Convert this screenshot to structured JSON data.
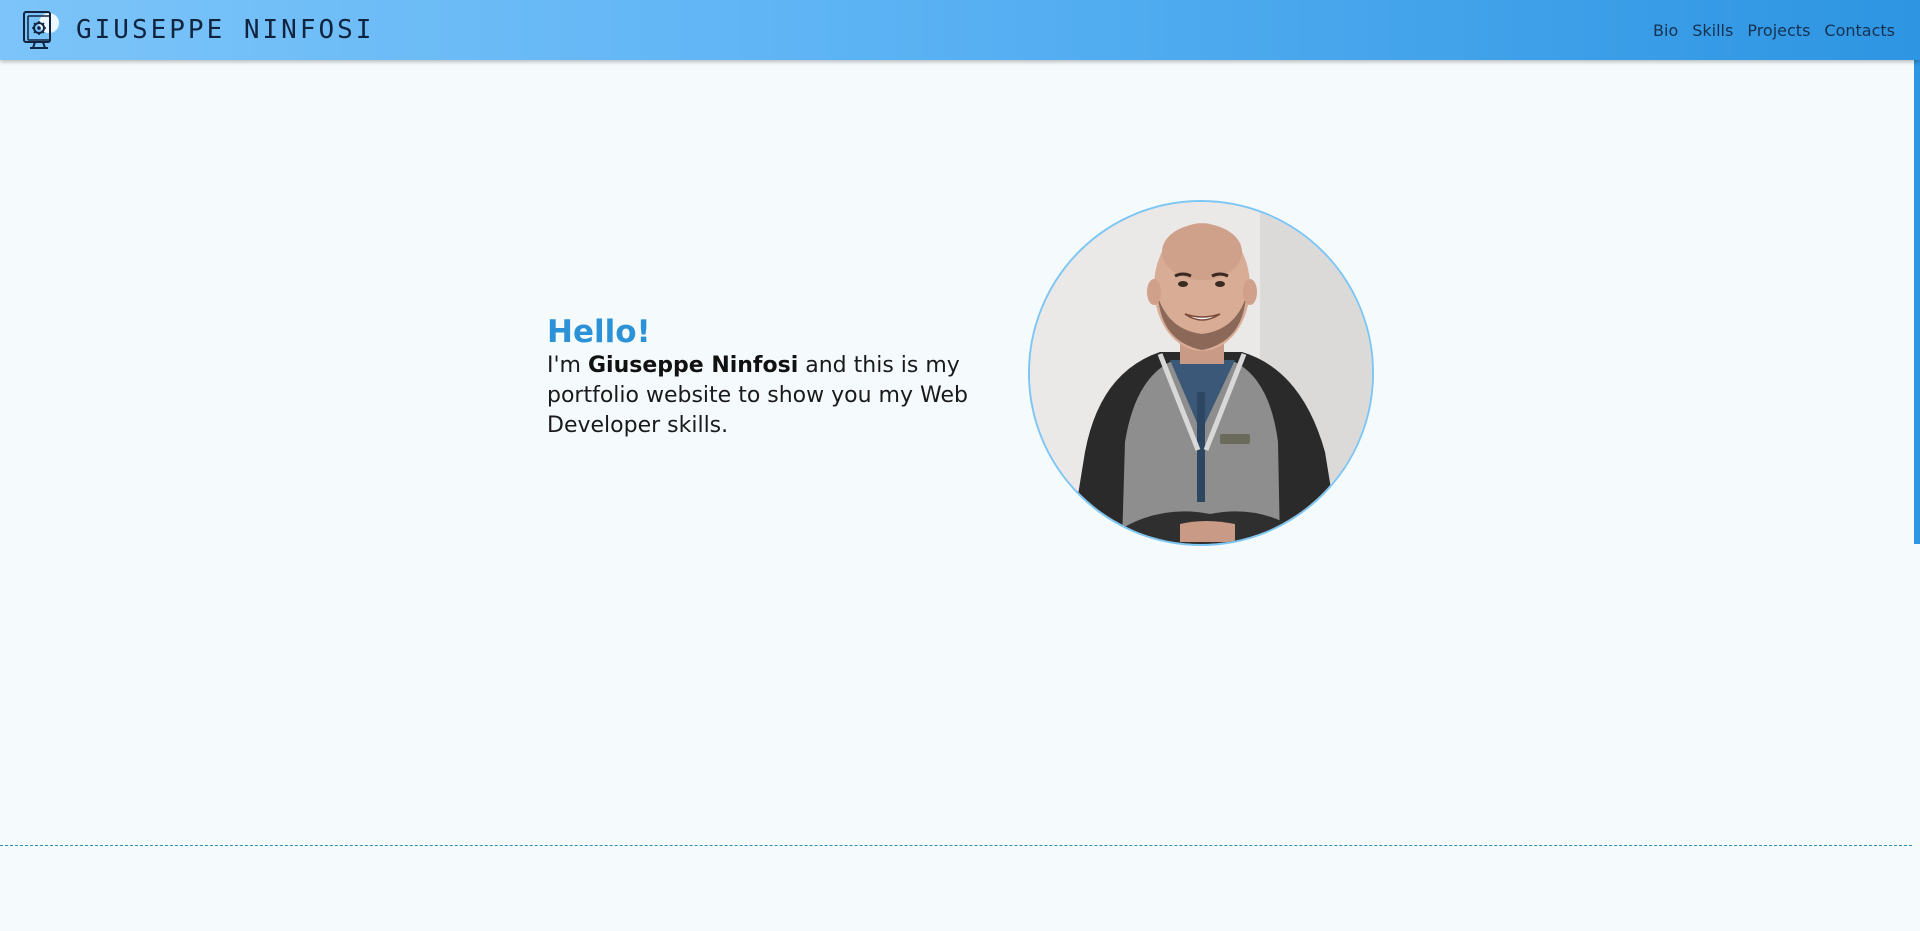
{
  "header": {
    "brand_name": "GIUSEPPE NINFOSI",
    "brand_icon": "monitor-gear-icon",
    "nav": [
      {
        "label": "Bio"
      },
      {
        "label": "Skills"
      },
      {
        "label": "Projects"
      },
      {
        "label": "Contacts"
      }
    ]
  },
  "hero": {
    "greeting": "Hello!",
    "intro_prefix": "I'm ",
    "intro_name": "Giuseppe Ninfosi",
    "intro_suffix": " and this is my portfolio website to show you my Web Developer skills."
  },
  "colors": {
    "accent": "#2b92d8",
    "nav_gradient_start": "#7cc4f9",
    "nav_gradient_end": "#2d95e2",
    "page_background": "#f5fbfd",
    "portrait_border": "#7cc6f6"
  }
}
